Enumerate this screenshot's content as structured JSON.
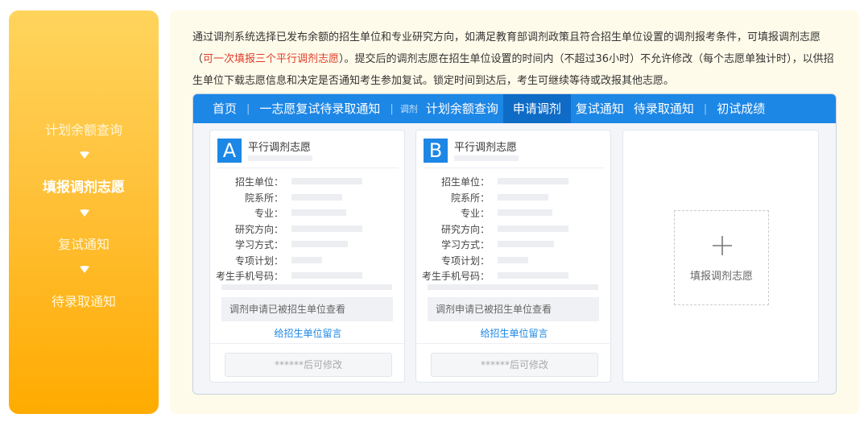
{
  "steps": [
    {
      "label": "计划余额查询",
      "active": false
    },
    {
      "label": "填报调剂志愿",
      "active": true
    },
    {
      "label": "复试通知",
      "active": false
    },
    {
      "label": "待录取通知",
      "active": false
    }
  ],
  "intro": {
    "part1": "通过调剂系统选择已发布余额的招生单位和专业研究方向，如满足教育部调剂政策且符合招生单位设置的调剂报考条件，可填报调剂志愿（",
    "highlight": "可一次填报三个平行调剂志愿",
    "part2": "）。提交后的调剂志愿在招生单位设置的时间内（不超过36小时）不允许修改（每个志愿单独计时），以供招生单位下载志愿信息和决定是否通知考生参加复试。锁定时间到达后，考生可继续等待或改报其他志愿。"
  },
  "nav": {
    "home": "首页",
    "first_choice": "一志愿复试待录取通知",
    "tiny_label": "调剂",
    "plan_query": "计划余额查询",
    "apply": "申请调剂",
    "retest": "复试通知",
    "admission": "待录取通知",
    "scores": "初试成绩",
    "separator": "|"
  },
  "cards": [
    {
      "letter": "A",
      "title": "平行调剂志愿",
      "fields": [
        "招生单位：",
        "院系所：",
        "专业：",
        "研究方向：",
        "学习方式：",
        "专项计划：",
        "考生手机号码："
      ],
      "notice": "调剂申请已被招生单位查看",
      "link": "给招生单位留言",
      "button": "******后可修改"
    },
    {
      "letter": "B",
      "title": "平行调剂志愿",
      "fields": [
        "招生单位：",
        "院系所：",
        "专业：",
        "研究方向：",
        "学习方式：",
        "专项计划：",
        "考生手机号码："
      ],
      "notice": "调剂申请已被招生单位查看",
      "link": "给招生单位留言",
      "button": "******后可修改"
    }
  ],
  "add_card": {
    "label": "填报调剂志愿",
    "icon": "plus-icon"
  },
  "colors": {
    "accent": "#1d87e6",
    "highlight": "#e03b2b",
    "step_gradient_top": "#ffd45c",
    "step_gradient_bottom": "#ffab00"
  }
}
